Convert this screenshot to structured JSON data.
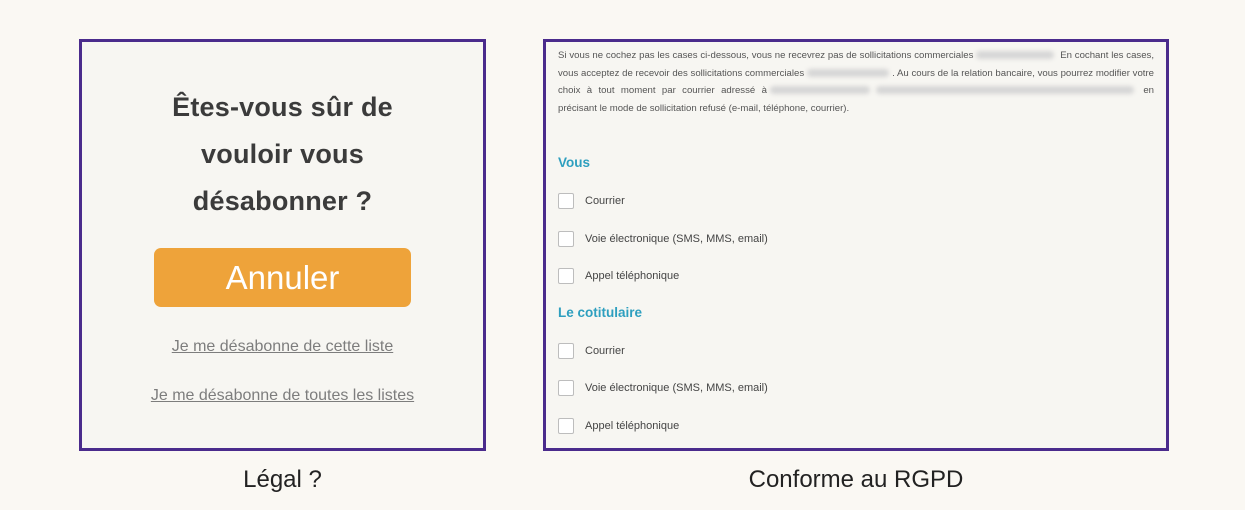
{
  "left_panel": {
    "question_lines": [
      "Êtes-vous sûr de",
      "vouloir vous",
      "désabonner ?"
    ],
    "cancel_button": "Annuler",
    "link_one": "Je me désabonne de cette liste",
    "link_all": "Je me désabonne de toutes les listes"
  },
  "right_panel": {
    "notice": {
      "line1": "Si vous ne cochez pas les cases ci-dessous, vous ne recevrez pas de sollicitations commerciales",
      "line2a": "En cochant les cases, vous acceptez de recevoir des sollicitations commerciales",
      "line2b": ". Au cours de la relation bancaire, vous pourrez modifier votre choix à tout moment par courrier adressé à",
      "line3": "en précisant le mode de sollicitation refusé (e-mail, téléphone, courrier)."
    },
    "sections": [
      {
        "title": "Vous",
        "options": [
          "Courrier",
          "Voie électronique (SMS, MMS, email)",
          "Appel téléphonique"
        ]
      },
      {
        "title": "Le cotitulaire",
        "options": [
          "Courrier",
          "Voie électronique (SMS, MMS, email)",
          "Appel téléphonique"
        ]
      }
    ]
  },
  "captions": {
    "left": "Légal ?",
    "right": "Conforme au RGPD"
  },
  "colors": {
    "frame": "#4a2b8c",
    "button": "#eea33a",
    "section_title": "#2e9fbf"
  }
}
